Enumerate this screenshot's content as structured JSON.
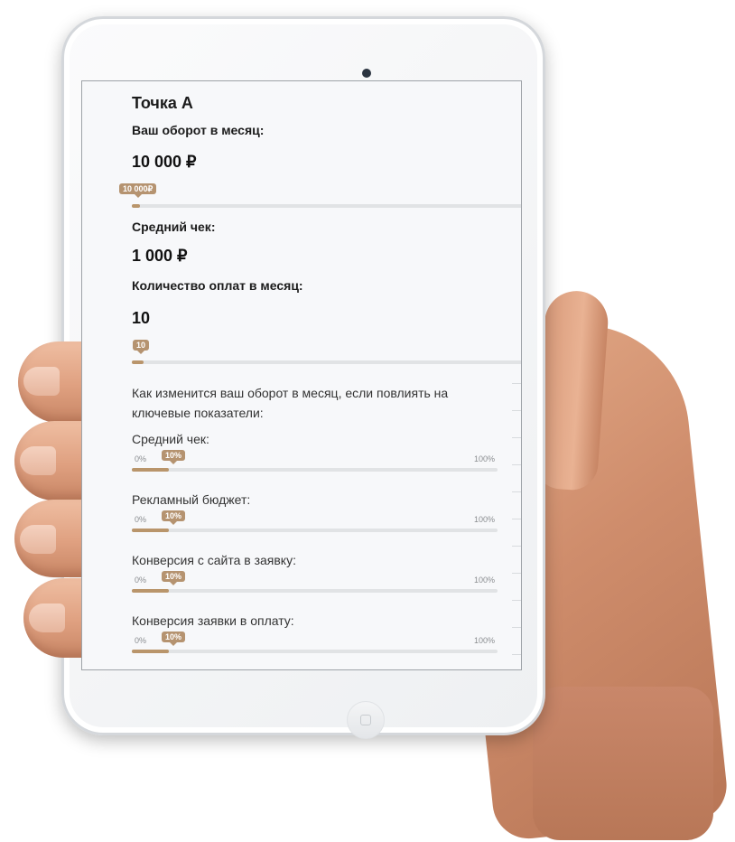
{
  "accent_color": "#b9956b",
  "screen": {
    "title": "Точка А",
    "turnover": {
      "label": "Ваш оборот в месяц:",
      "value": "10 000 ₽",
      "badge": "10 000₽",
      "fill_fraction": 0.02
    },
    "avg_check": {
      "label": "Средний чек:",
      "value": "1 000 ₽"
    },
    "payments": {
      "label": "Количество оплат в месяц:",
      "value": "10",
      "badge": "10",
      "fill_fraction": 0.03
    },
    "question": "Как изменится ваш оборот в месяц, если повлиять на ключевые показатели:",
    "factors": [
      {
        "label": "Средний чек:",
        "min": "0%",
        "max": "100%",
        "badge": "10%",
        "value": 0.1
      },
      {
        "label": "Рекламный бюджет:",
        "min": "0%",
        "max": "100%",
        "badge": "10%",
        "value": 0.1
      },
      {
        "label": "Конверсия с сайта в заявку:",
        "min": "0%",
        "max": "100%",
        "badge": "10%",
        "value": 0.1
      },
      {
        "label": "Конверсия заявки в оплату:",
        "min": "0%",
        "max": "100%",
        "badge": "10%",
        "value": 0.1
      }
    ]
  }
}
